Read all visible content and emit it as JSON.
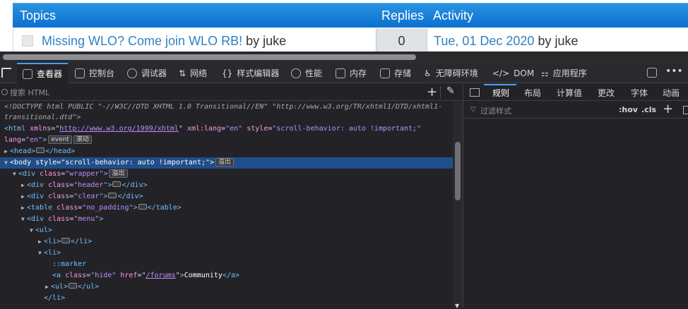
{
  "forum": {
    "headers": {
      "topics": "Topics",
      "replies": "Replies",
      "activity": "Activity"
    },
    "row": {
      "topic_link": "Missing WLO? Come join WLO RB!",
      "topic_by": " by juke",
      "replies": "0",
      "activity_link": "Tue, 01 Dec 2020",
      "activity_by": " by juke"
    }
  },
  "toolbar": {
    "tabs": {
      "inspector": "查看器",
      "console": "控制台",
      "debugger": "调试器",
      "network": "网络",
      "style_editor": "样式编辑器",
      "performance": "性能",
      "memory": "内存",
      "storage": "存储",
      "accessibility": "无障碍环境",
      "dom": "DOM",
      "application": "应用程序"
    }
  },
  "inspector": {
    "search_placeholder": "搜索 HTML",
    "lines": {
      "doctype_a": "<!DOCTYPE html PUBLIC \"-//W3C//DTD XHTML 1.0 Transitional//EN\" \"http://www.w3.org/TR/xhtml1/DTD/xhtml1-",
      "doctype_b": "transitional.dtd\">",
      "html_tag": "<html",
      "html_xmlns_attr": "xmlns",
      "html_xmlns_val": "http://www.w3.org/1999/xhtml",
      "html_lang_attr": "xml:lang",
      "html_lang_val": "\"en\"",
      "html_style_attr": "style",
      "html_style_val": "\"scroll-behavior: auto !important;\"",
      "lang_attr": "lang",
      "lang_val": "\"en\"",
      "event_badge": "event",
      "scroll_badge": "滚动",
      "head_open": "<head>",
      "head_close": "</head>",
      "body_tag": "<body",
      "body_style_attr": "style",
      "body_style_val": "\"scroll-behavior: auto !important;\"",
      "overflow_badge": "溢出",
      "div": "<div",
      "div_close": "</div>",
      "class_attr": "class",
      "wrapper_val": "\"wrapper\"",
      "header_val": "\"header\"",
      "clear_val": "\"clear\"",
      "table": "<table",
      "table_close": "</table>",
      "no_padding_val": "\"no_padding\"",
      "menu_val": "\"menu\"",
      "ul": "<ul>",
      "ul_close": "</ul>",
      "li": "<li>",
      "li_close": "</li>",
      "marker": "::marker",
      "a_tag": "<a",
      "hide_val": "\"hide\"",
      "href_attr": "href",
      "href_val": "/forums",
      "community": "Community",
      "a_close": "</a>"
    }
  },
  "sidebar": {
    "tabs": {
      "rules": "规则",
      "layout": "布局",
      "computed": "计算值",
      "changes": "更改",
      "fonts": "字体",
      "animations": "动画"
    },
    "filter_placeholder": "过滤样式",
    "hov": ":hov",
    "cls": ".cls"
  }
}
